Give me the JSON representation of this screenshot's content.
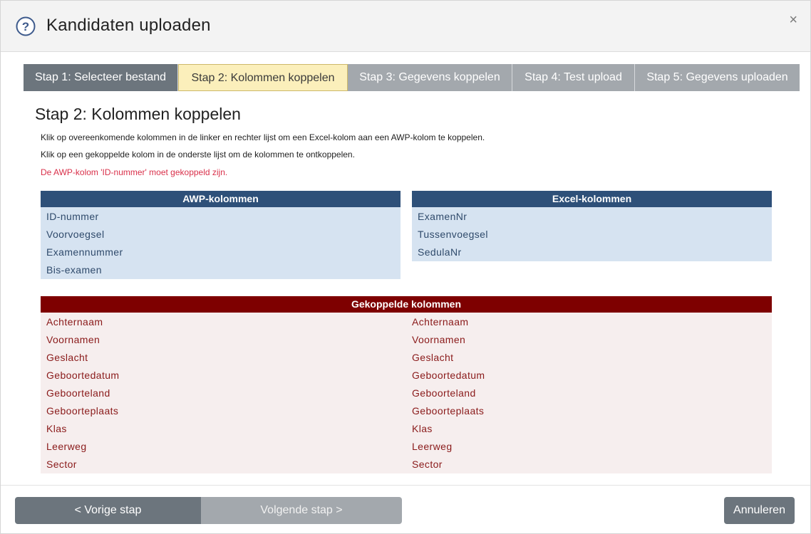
{
  "header": {
    "title": "Kandidaten uploaden",
    "help_icon": "question-circle-icon",
    "close_label": "×"
  },
  "steps": [
    {
      "label": "Stap 1: Selecteer bestand",
      "state": "done"
    },
    {
      "label": "Stap 2: Kolommen koppelen",
      "state": "active"
    },
    {
      "label": "Stap 3: Gegevens koppelen",
      "state": "pending"
    },
    {
      "label": "Stap 4: Test upload",
      "state": "pending"
    },
    {
      "label": "Stap 5: Gegevens uploaden",
      "state": "pending"
    }
  ],
  "section": {
    "title": "Stap 2: Kolommen koppelen",
    "info_1": "Klik op overeenkomende kolommen in de linker en rechter lijst om een Excel-kolom aan een AWP-kolom te koppelen.",
    "info_2": "Klik op een gekoppelde kolom in de onderste lijst om de kolommen te ontkoppelen.",
    "warning": "De AWP-kolom 'ID-nummer' moet gekoppeld zijn."
  },
  "awp": {
    "header": "AWP-kolommen",
    "items": [
      "ID-nummer",
      "Voorvoegsel",
      "Examennummer",
      "Bis-examen"
    ]
  },
  "excel": {
    "header": "Excel-kolommen",
    "items": [
      "ExamenNr",
      "Tussenvoegsel",
      "SedulaNr"
    ]
  },
  "linked": {
    "header": "Gekoppelde kolommen",
    "rows": [
      {
        "awp": "Achternaam",
        "excel": "Achternaam"
      },
      {
        "awp": "Voornamen",
        "excel": "Voornamen"
      },
      {
        "awp": "Geslacht",
        "excel": "Geslacht"
      },
      {
        "awp": "Geboortedatum",
        "excel": "Geboortedatum"
      },
      {
        "awp": "Geboorteland",
        "excel": "Geboorteland"
      },
      {
        "awp": "Geboorteplaats",
        "excel": "Geboorteplaats"
      },
      {
        "awp": "Klas",
        "excel": "Klas"
      },
      {
        "awp": "Leerweg",
        "excel": "Leerweg"
      },
      {
        "awp": "Sector",
        "excel": "Sector"
      }
    ]
  },
  "footer": {
    "prev_label": "< Vorige stap",
    "next_label": "Volgende stap >",
    "cancel_label": "Annuleren"
  },
  "colors": {
    "awp_header": "#2e5079",
    "list_body": "#d6e3f1",
    "linked_header": "#7e0000",
    "linked_body": "#f6eeee",
    "active_step": "#fbefbb",
    "warning_text": "#d9304a"
  }
}
